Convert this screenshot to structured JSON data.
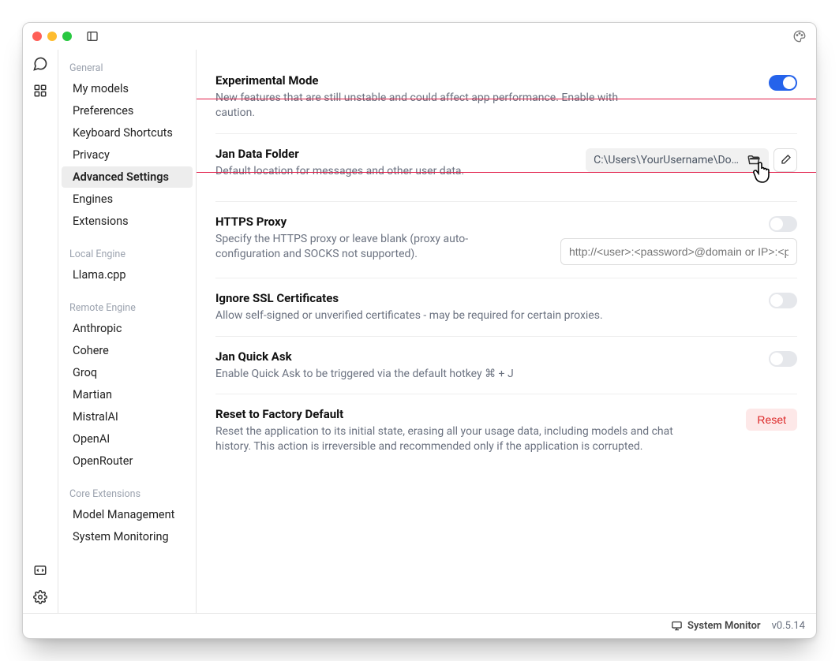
{
  "sidebar": {
    "groups": [
      {
        "label": "General",
        "items": [
          {
            "label": "My models",
            "active": false
          },
          {
            "label": "Preferences",
            "active": false
          },
          {
            "label": "Keyboard Shortcuts",
            "active": false
          },
          {
            "label": "Privacy",
            "active": false
          },
          {
            "label": "Advanced Settings",
            "active": true
          },
          {
            "label": "Engines",
            "active": false
          },
          {
            "label": "Extensions",
            "active": false
          }
        ]
      },
      {
        "label": "Local Engine",
        "items": [
          {
            "label": "Llama.cpp",
            "active": false
          }
        ]
      },
      {
        "label": "Remote Engine",
        "items": [
          {
            "label": "Anthropic",
            "active": false
          },
          {
            "label": "Cohere",
            "active": false
          },
          {
            "label": "Groq",
            "active": false
          },
          {
            "label": "Martian",
            "active": false
          },
          {
            "label": "MistralAI",
            "active": false
          },
          {
            "label": "OpenAI",
            "active": false
          },
          {
            "label": "OpenRouter",
            "active": false
          }
        ]
      },
      {
        "label": "Core Extensions",
        "items": [
          {
            "label": "Model Management",
            "active": false
          },
          {
            "label": "System Monitoring",
            "active": false
          }
        ]
      }
    ]
  },
  "settings": {
    "experimental": {
      "title": "Experimental Mode",
      "desc": "New features that are still unstable and could affect app performance. Enable with caution.",
      "on": true
    },
    "dataFolder": {
      "title": "Jan Data Folder",
      "desc": "Default location for messages and other user data.",
      "path": "C:\\Users\\YourUsername\\Do…"
    },
    "proxy": {
      "title": "HTTPS Proxy",
      "desc": "Specify the HTTPS proxy or leave blank (proxy auto-configuration and SOCKS not supported).",
      "placeholder": "http://<user>:<password>@domain or IP>:<po…",
      "on": false
    },
    "ssl": {
      "title": "Ignore SSL Certificates",
      "desc": "Allow self-signed or unverified certificates - may be required for certain proxies.",
      "on": false
    },
    "quickAsk": {
      "title": "Jan Quick Ask",
      "desc": "Enable Quick Ask to be triggered via the default hotkey ⌘ + J",
      "on": false
    },
    "reset": {
      "title": "Reset to Factory Default",
      "desc": "Reset the application to its initial state, erasing all your usage data, including models and chat history. This action is irreversible and recommended only if the application is corrupted.",
      "button": "Reset"
    }
  },
  "status": {
    "monitor": "System Monitor",
    "version": "v0.5.14"
  }
}
